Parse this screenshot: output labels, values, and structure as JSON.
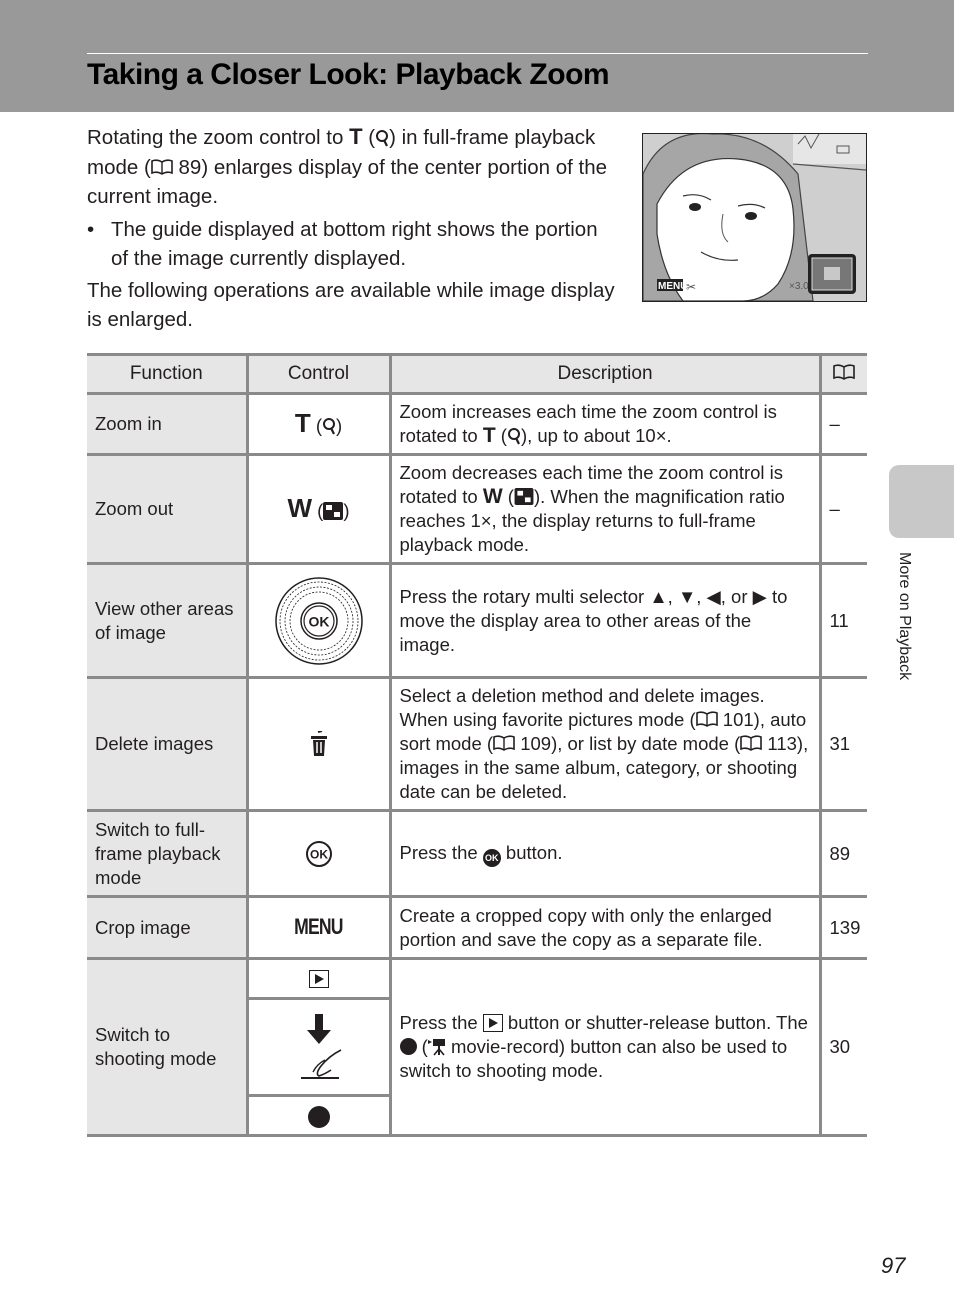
{
  "header": {
    "title": "Taking a Closer Look: Playback Zoom"
  },
  "intro": {
    "p1_a": "Rotating the zoom control to ",
    "p1_t": "T",
    "p1_b": " (",
    "p1_c": ") in full-frame playback mode (",
    "p1_ref": " 89",
    "p1_d": ") enlarges display of the center portion of the current image.",
    "bullet_symbol": "•",
    "bullet": "The guide displayed at bottom right shows the portion of the image currently displayed.",
    "p2": "The following operations are available while image display is enlarged."
  },
  "screen": {
    "menu_label": "MENU",
    "zoom_readout": "×3.0",
    "icons": [
      "scissors-icon",
      "battery-icon",
      "zoom-guide-icon"
    ]
  },
  "table": {
    "headers": {
      "function": "Function",
      "control": "Control",
      "description": "Description",
      "page_icon": "book-icon"
    },
    "rows": [
      {
        "function": "Zoom in",
        "control_letter": "T",
        "control_icon": "magnify-icon",
        "desc_a": "Zoom increases each time the zoom control is rotated to ",
        "desc_t": "T",
        "desc_b": " (",
        "desc_c": "), up to about 10×.",
        "page": "–"
      },
      {
        "function": "Zoom out",
        "control_letter": "W",
        "control_icon": "thumbnail-icon",
        "desc_a": "Zoom decreases each time the zoom control is rotated to ",
        "desc_w": "W",
        "desc_b": " (",
        "desc_c": "). When the magnification ratio reaches 1×, the display returns to full-frame playback mode.",
        "page": "–"
      },
      {
        "function": "View other areas of image",
        "control_icon": "rotary-multi-selector-icon",
        "control_ok": "OK",
        "desc_a": "Press the rotary multi selector ",
        "arrows": [
          "▲",
          "▼",
          "◀",
          "▶"
        ],
        "sep": ", ",
        "or": ", or ",
        "desc_b": " to move the display area to other areas of the image.",
        "page": "11"
      },
      {
        "function": "Delete images",
        "control_icon": "trash-icon",
        "desc_a": "Select a deletion method and delete images. When using favorite pictures mode (",
        "ref1": " 101",
        "desc_b": "), auto sort mode (",
        "ref2": " 109",
        "desc_c": "), or list by date mode (",
        "ref3": " 113",
        "desc_d": "), images in the same album, category, or shooting date can be deleted.",
        "page": "31"
      },
      {
        "function": "Switch to full-frame playback mode",
        "control_icon": "ok-button-icon",
        "control_ok": "OK",
        "desc_a": "Press the ",
        "desc_b": " button.",
        "page": "89"
      },
      {
        "function": "Crop image",
        "control_label": "MENU",
        "desc": "Create a cropped copy with only the enlarged portion and save the copy as a separate file.",
        "page": "139"
      },
      {
        "function": "Switch to shooting mode",
        "controls": [
          "playback-button-icon",
          "shutter-release-icon",
          "movie-record-icon"
        ],
        "desc_a": "Press the ",
        "desc_b": " button or shutter-release button. The ",
        "desc_c": " (",
        "desc_d": " movie-record) button can also be used to switch to shooting mode.",
        "page": "30"
      }
    ]
  },
  "side_tab": {
    "label": "More on Playback"
  },
  "footer": {
    "page_number": "97"
  }
}
